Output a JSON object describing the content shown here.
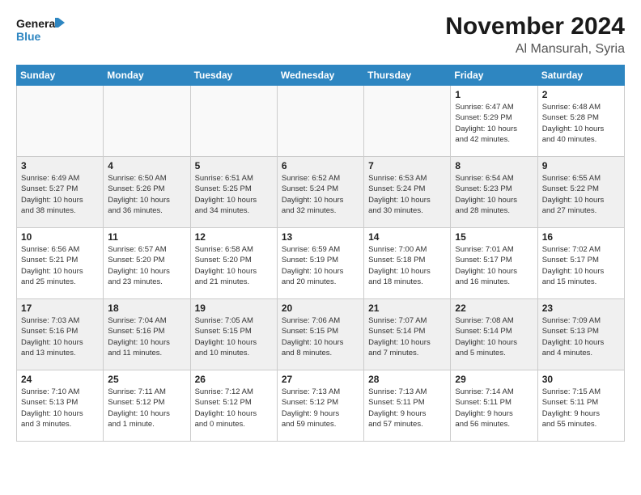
{
  "header": {
    "logo_line1": "General",
    "logo_line2": "Blue",
    "month": "November 2024",
    "location": "Al Mansurah, Syria"
  },
  "weekdays": [
    "Sunday",
    "Monday",
    "Tuesday",
    "Wednesday",
    "Thursday",
    "Friday",
    "Saturday"
  ],
  "weeks": [
    [
      {
        "day": "",
        "info": ""
      },
      {
        "day": "",
        "info": ""
      },
      {
        "day": "",
        "info": ""
      },
      {
        "day": "",
        "info": ""
      },
      {
        "day": "",
        "info": ""
      },
      {
        "day": "1",
        "info": "Sunrise: 6:47 AM\nSunset: 5:29 PM\nDaylight: 10 hours\nand 42 minutes."
      },
      {
        "day": "2",
        "info": "Sunrise: 6:48 AM\nSunset: 5:28 PM\nDaylight: 10 hours\nand 40 minutes."
      }
    ],
    [
      {
        "day": "3",
        "info": "Sunrise: 6:49 AM\nSunset: 5:27 PM\nDaylight: 10 hours\nand 38 minutes."
      },
      {
        "day": "4",
        "info": "Sunrise: 6:50 AM\nSunset: 5:26 PM\nDaylight: 10 hours\nand 36 minutes."
      },
      {
        "day": "5",
        "info": "Sunrise: 6:51 AM\nSunset: 5:25 PM\nDaylight: 10 hours\nand 34 minutes."
      },
      {
        "day": "6",
        "info": "Sunrise: 6:52 AM\nSunset: 5:24 PM\nDaylight: 10 hours\nand 32 minutes."
      },
      {
        "day": "7",
        "info": "Sunrise: 6:53 AM\nSunset: 5:24 PM\nDaylight: 10 hours\nand 30 minutes."
      },
      {
        "day": "8",
        "info": "Sunrise: 6:54 AM\nSunset: 5:23 PM\nDaylight: 10 hours\nand 28 minutes."
      },
      {
        "day": "9",
        "info": "Sunrise: 6:55 AM\nSunset: 5:22 PM\nDaylight: 10 hours\nand 27 minutes."
      }
    ],
    [
      {
        "day": "10",
        "info": "Sunrise: 6:56 AM\nSunset: 5:21 PM\nDaylight: 10 hours\nand 25 minutes."
      },
      {
        "day": "11",
        "info": "Sunrise: 6:57 AM\nSunset: 5:20 PM\nDaylight: 10 hours\nand 23 minutes."
      },
      {
        "day": "12",
        "info": "Sunrise: 6:58 AM\nSunset: 5:20 PM\nDaylight: 10 hours\nand 21 minutes."
      },
      {
        "day": "13",
        "info": "Sunrise: 6:59 AM\nSunset: 5:19 PM\nDaylight: 10 hours\nand 20 minutes."
      },
      {
        "day": "14",
        "info": "Sunrise: 7:00 AM\nSunset: 5:18 PM\nDaylight: 10 hours\nand 18 minutes."
      },
      {
        "day": "15",
        "info": "Sunrise: 7:01 AM\nSunset: 5:17 PM\nDaylight: 10 hours\nand 16 minutes."
      },
      {
        "day": "16",
        "info": "Sunrise: 7:02 AM\nSunset: 5:17 PM\nDaylight: 10 hours\nand 15 minutes."
      }
    ],
    [
      {
        "day": "17",
        "info": "Sunrise: 7:03 AM\nSunset: 5:16 PM\nDaylight: 10 hours\nand 13 minutes."
      },
      {
        "day": "18",
        "info": "Sunrise: 7:04 AM\nSunset: 5:16 PM\nDaylight: 10 hours\nand 11 minutes."
      },
      {
        "day": "19",
        "info": "Sunrise: 7:05 AM\nSunset: 5:15 PM\nDaylight: 10 hours\nand 10 minutes."
      },
      {
        "day": "20",
        "info": "Sunrise: 7:06 AM\nSunset: 5:15 PM\nDaylight: 10 hours\nand 8 minutes."
      },
      {
        "day": "21",
        "info": "Sunrise: 7:07 AM\nSunset: 5:14 PM\nDaylight: 10 hours\nand 7 minutes."
      },
      {
        "day": "22",
        "info": "Sunrise: 7:08 AM\nSunset: 5:14 PM\nDaylight: 10 hours\nand 5 minutes."
      },
      {
        "day": "23",
        "info": "Sunrise: 7:09 AM\nSunset: 5:13 PM\nDaylight: 10 hours\nand 4 minutes."
      }
    ],
    [
      {
        "day": "24",
        "info": "Sunrise: 7:10 AM\nSunset: 5:13 PM\nDaylight: 10 hours\nand 3 minutes."
      },
      {
        "day": "25",
        "info": "Sunrise: 7:11 AM\nSunset: 5:12 PM\nDaylight: 10 hours\nand 1 minute."
      },
      {
        "day": "26",
        "info": "Sunrise: 7:12 AM\nSunset: 5:12 PM\nDaylight: 10 hours\nand 0 minutes."
      },
      {
        "day": "27",
        "info": "Sunrise: 7:13 AM\nSunset: 5:12 PM\nDaylight: 9 hours\nand 59 minutes."
      },
      {
        "day": "28",
        "info": "Sunrise: 7:13 AM\nSunset: 5:11 PM\nDaylight: 9 hours\nand 57 minutes."
      },
      {
        "day": "29",
        "info": "Sunrise: 7:14 AM\nSunset: 5:11 PM\nDaylight: 9 hours\nand 56 minutes."
      },
      {
        "day": "30",
        "info": "Sunrise: 7:15 AM\nSunset: 5:11 PM\nDaylight: 9 hours\nand 55 minutes."
      }
    ]
  ]
}
